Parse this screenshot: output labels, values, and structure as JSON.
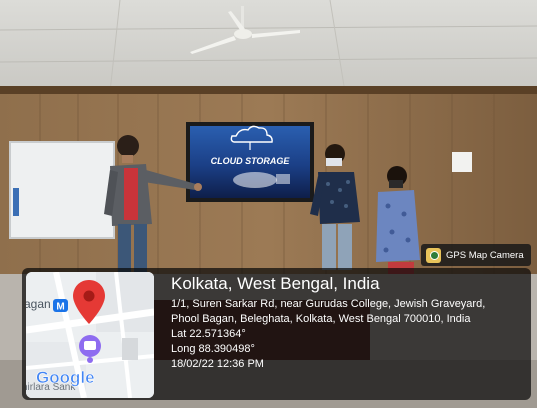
{
  "badge": {
    "label": "GPS Map Camera",
    "icon": "gps-map-camera-app-icon"
  },
  "location": {
    "title": "Kolkata, West Bengal, India",
    "address_line1": "1/1, Suren Sarkar Rd, near Gurudas College, Jewish Graveyard,",
    "address_line2": "Phool Bagan, Beleghata, Kolkata, West Bengal 700010, India",
    "latitude": "Lat 22.571364°",
    "longitude": "Long 88.390498°",
    "datetime": "18/02/22 12:36 PM"
  },
  "map": {
    "place_fragment": "agan",
    "metro_badge": "M",
    "street_fragment": "hirlara Sank",
    "logo": "Google",
    "pin_color": "#e53935"
  },
  "slide": {
    "title": "CLOUD STORAGE"
  }
}
